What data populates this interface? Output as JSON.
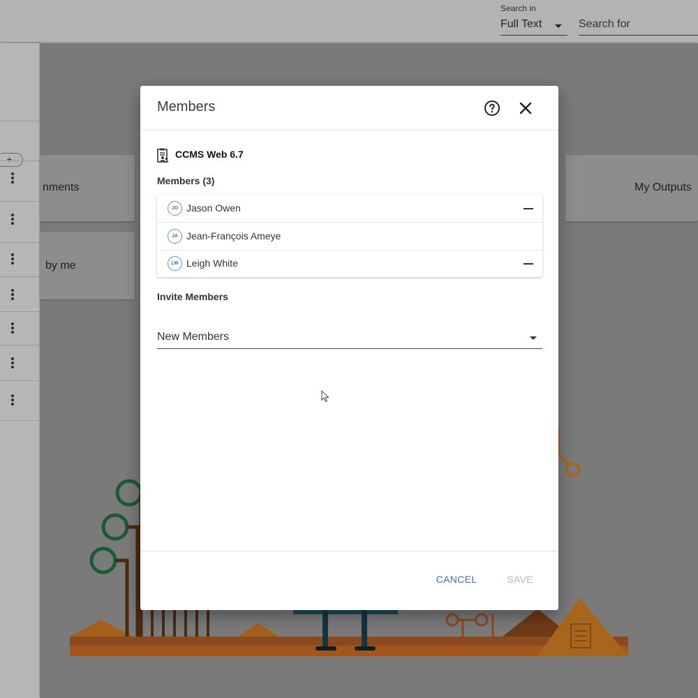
{
  "header": {
    "search_in_label": "Search in",
    "search_in_value": "Full Text",
    "search_for_placeholder": "Search for"
  },
  "background": {
    "add_label": "+",
    "card_left_text_1": "nments",
    "card_left_text_2": "by me",
    "card_right_text": "My Outputs"
  },
  "dialog": {
    "title": "Members",
    "help_icon": "help-circle-icon",
    "close_icon": "close-icon",
    "project": {
      "icon": "project-document-users-icon",
      "name": "CCMS Web 6.7"
    },
    "members_heading": "Members (3)",
    "members": [
      {
        "initials": "JO",
        "name": "Jason Owen",
        "removable": true
      },
      {
        "initials": "JA",
        "name": "Jean-François Ameye",
        "removable": false
      },
      {
        "initials": "LW",
        "name": "Leigh White",
        "removable": true
      }
    ],
    "invite_heading": "Invite Members",
    "new_members_label": "New Members",
    "cancel_label": "CANCEL",
    "save_label": "SAVE"
  },
  "colors": {
    "accent": "#4a6fa5",
    "disabled": "#b8b8b8",
    "overlay": "#7a7a7a"
  }
}
